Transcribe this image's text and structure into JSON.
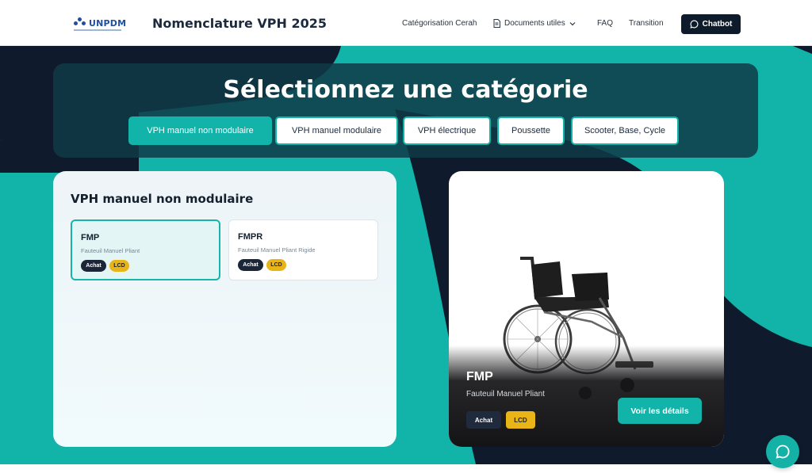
{
  "header": {
    "logo_text": "UNPDM",
    "title": "Nomenclature VPH 2025",
    "nav": {
      "categorisation": "Catégorisation Cerah",
      "documents": "Documents utiles",
      "faq": "FAQ",
      "transition": "Transition"
    },
    "chatbot_label": "Chatbot"
  },
  "categories": {
    "heading": "Sélectionnez une catégorie",
    "items": [
      {
        "label": "VPH manuel non modulaire",
        "active": true
      },
      {
        "label": "VPH manuel modulaire",
        "active": false
      },
      {
        "label": "VPH électrique",
        "active": false
      },
      {
        "label": "Poussette",
        "active": false
      },
      {
        "label": "Scooter, Base, Cycle",
        "active": false
      }
    ]
  },
  "list_panel": {
    "title": "VPH manuel non modulaire",
    "items": [
      {
        "code": "FMP",
        "description": "Fauteuil Manuel Pliant",
        "badges": [
          "Achat",
          "LCD"
        ],
        "selected": true
      },
      {
        "code": "FMPR",
        "description": "Fauteuil Manuel Pliant Rigide",
        "badges": [
          "Achat",
          "LCD"
        ],
        "selected": false
      }
    ]
  },
  "detail_panel": {
    "code": "FMP",
    "description": "Fauteuil Manuel Pliant",
    "badges": [
      "Achat",
      "LCD"
    ],
    "details_button": "Voir les détails",
    "image_icon": "wheelchair-image"
  },
  "colors": {
    "accent": "#12b3a8",
    "dark": "#0d1b2a",
    "badge_yellow": "#e8b417"
  }
}
